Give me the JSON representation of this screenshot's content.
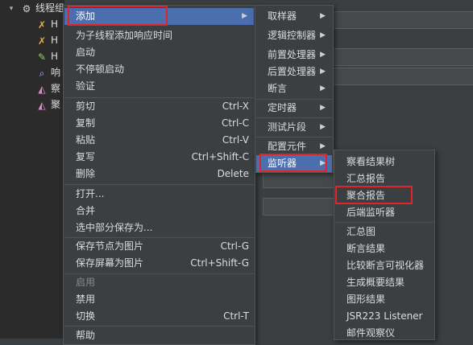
{
  "tree": {
    "root_label": "线程组",
    "items": [
      {
        "label": "H",
        "icon": "wrench-icon"
      },
      {
        "label": "H",
        "icon": "wrench-icon"
      },
      {
        "label": "H",
        "icon": "pencil-icon"
      },
      {
        "label": "响",
        "icon": "magnifier-icon"
      },
      {
        "label": "察",
        "icon": "graph-icon"
      },
      {
        "label": "聚",
        "icon": "graph-icon"
      }
    ]
  },
  "context_menu": {
    "items": [
      {
        "label": "添加",
        "shortcut": "",
        "submenu": true,
        "selected": true
      },
      {
        "label": "为子线程添加响应时间",
        "shortcut": ""
      },
      {
        "label": "启动",
        "shortcut": ""
      },
      {
        "label": "不停顿启动",
        "shortcut": ""
      },
      {
        "label": "验证",
        "shortcut": ""
      },
      {
        "label": "剪切",
        "shortcut": "Ctrl-X"
      },
      {
        "label": "复制",
        "shortcut": "Ctrl-C"
      },
      {
        "label": "粘贴",
        "shortcut": "Ctrl-V"
      },
      {
        "label": "复写",
        "shortcut": "Ctrl+Shift-C"
      },
      {
        "label": "删除",
        "shortcut": "Delete"
      },
      {
        "label": "打开...",
        "shortcut": ""
      },
      {
        "label": "合并",
        "shortcut": ""
      },
      {
        "label": "选中部分保存为...",
        "shortcut": ""
      },
      {
        "label": "保存节点为图片",
        "shortcut": "Ctrl-G"
      },
      {
        "label": "保存屏幕为图片",
        "shortcut": "Ctrl+Shift-G"
      },
      {
        "label": "启用",
        "shortcut": "",
        "disabled": true
      },
      {
        "label": "禁用",
        "shortcut": ""
      },
      {
        "label": "切换",
        "shortcut": "Ctrl-T"
      },
      {
        "label": "帮助",
        "shortcut": ""
      }
    ]
  },
  "add_submenu": {
    "items": [
      {
        "label": "取样器"
      },
      {
        "label": "逻辑控制器"
      },
      {
        "label": "前置处理器"
      },
      {
        "label": "后置处理器"
      },
      {
        "label": "断言"
      },
      {
        "label": "定时器"
      },
      {
        "label": "测试片段"
      },
      {
        "label": "配置元件"
      },
      {
        "label": "监听器",
        "selected": true
      }
    ]
  },
  "listener_submenu": {
    "items": [
      {
        "label": "察看结果树"
      },
      {
        "label": "汇总报告"
      },
      {
        "label": "聚合报告",
        "highlighted": true
      },
      {
        "label": "后端监听器"
      },
      {
        "label": "汇总图"
      },
      {
        "label": "断言结果"
      },
      {
        "label": "比较断言可视化器"
      },
      {
        "label": "生成概要结果"
      },
      {
        "label": "图形结果"
      },
      {
        "label": "JSR223 Listener"
      },
      {
        "label": "邮件观察仪"
      }
    ]
  },
  "colors": {
    "selection": "#4b6eaf",
    "highlight_box": "#e0242a",
    "menu_bg": "#3c3f41"
  }
}
